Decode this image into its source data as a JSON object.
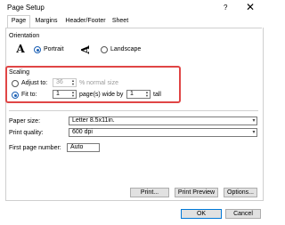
{
  "window": {
    "title": "Page Setup",
    "help": "?",
    "close": "✕"
  },
  "tabs": [
    "Page",
    "Margins",
    "Header/Footer",
    "Sheet"
  ],
  "orientation": {
    "label": "Orientation",
    "portrait": "Portrait",
    "landscape": "Landscape",
    "icon_glyph": "A"
  },
  "scaling": {
    "label": "Scaling",
    "adjust_to": "Adjust to:",
    "adjust_value": "36",
    "adjust_suffix": "% normal size",
    "fit_to": "Fit to:",
    "fit_wide_value": "1",
    "fit_wide_suffix": "page(s) wide by",
    "fit_tall_value": "1",
    "fit_tall_suffix": "tall"
  },
  "paper_size": {
    "label": "Paper size:",
    "value": "Letter 8.5x11in."
  },
  "print_quality": {
    "label": "Print quality:",
    "value": "600 dpi"
  },
  "first_page": {
    "label": "First page number:",
    "value": "Auto"
  },
  "buttons": {
    "print": "Print...",
    "print_preview": "Print Preview",
    "options": "Options...",
    "ok": "OK",
    "cancel": "Cancel"
  },
  "colors": {
    "highlight": "#e04545",
    "accent": "#0078d7"
  }
}
